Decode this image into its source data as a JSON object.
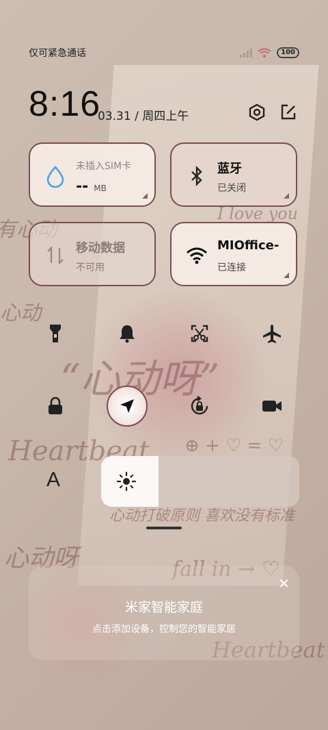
{
  "status_bar": {
    "carrier_text": "仅可紧急通话",
    "battery": "100",
    "icons": [
      "signal-icon",
      "wifi-icon",
      "battery-icon"
    ]
  },
  "clock": {
    "time": "8:16",
    "date": "03.31 / 周四上午"
  },
  "header_icons": [
    "settings-icon",
    "edit-icon"
  ],
  "tiles": {
    "sim": {
      "title": "未插入SIM卡",
      "value": "--",
      "unit": "MB"
    },
    "bluetooth": {
      "title": "蓝牙",
      "status": "已关闭"
    },
    "mobile_data": {
      "title": "移动数据",
      "status": "不可用"
    },
    "wifi": {
      "title": "MIOffice-",
      "status": "已连接"
    }
  },
  "toggles_row1": [
    "flashlight-icon",
    "bell-icon",
    "screenshot-icon",
    "airplane-icon"
  ],
  "toggles_row2": [
    "lock-icon",
    "location-icon",
    "rotation-lock-icon",
    "video-icon"
  ],
  "brightness": {
    "level": 0.29,
    "font_label": "A"
  },
  "smart_home": {
    "title": "米家智能家庭",
    "subtitle": "点击添加设备，控制您的智能家居",
    "close": "✕"
  },
  "wallpaper_doodles": {
    "big": "“心动呀”",
    "left_top": "有心动",
    "love": "I love you",
    "left_mid": "心动",
    "heartbeat1": "Heartbeat",
    "equation": "⊕ + ♡ = ♡",
    "line": "心动打破原则 喜欢没有标准",
    "bottom_left": "心动呀",
    "fall": "fall in → ♡",
    "heartbeat2": "Heartbeat"
  },
  "colors": {
    "tile_border": "#7a4d52",
    "tile_bg": "#f6ece6",
    "wifi_blue": "#4aa3e0"
  }
}
